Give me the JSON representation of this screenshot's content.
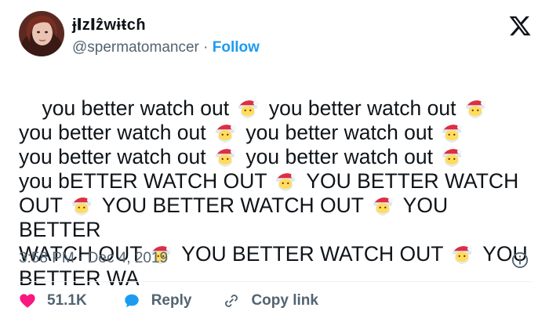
{
  "author": {
    "display_name": "ɉ𝐈z𝐈ẑwɨŧcɦ",
    "handle": "@spermatomancer",
    "separator": "·",
    "follow_label": "Follow"
  },
  "tweet": {
    "segments": [
      "you better watch out ",
      " you better watch out ",
      "\nyou better watch out ",
      " you better watch out ",
      "\nyou better watch out ",
      " you better watch out ",
      "\nyou bETTER WATCH OUT ",
      " YOU BETTER WATCH\nOUT ",
      " YOU BETTER WATCH OUT ",
      " YOU BETTER\nWATCH OUT ",
      " YOU BETTER WATCH OUT ",
      " YOU\nBETTER WA"
    ],
    "emoji": "santa-emoji"
  },
  "meta": {
    "time": "3:58 PM",
    "separator": "·",
    "date": "Dec 4, 2019"
  },
  "actions": {
    "likes": "51.1K",
    "reply_label": "Reply",
    "copy_link_label": "Copy link"
  },
  "colors": {
    "accent": "#1d9bf0",
    "like": "#f91880",
    "muted": "#536471",
    "text": "#0f1419"
  },
  "icons": {
    "logo": "x-logo-icon",
    "info": "info-icon",
    "like": "heart-icon",
    "reply": "speech-bubble-icon",
    "copy": "link-icon"
  }
}
